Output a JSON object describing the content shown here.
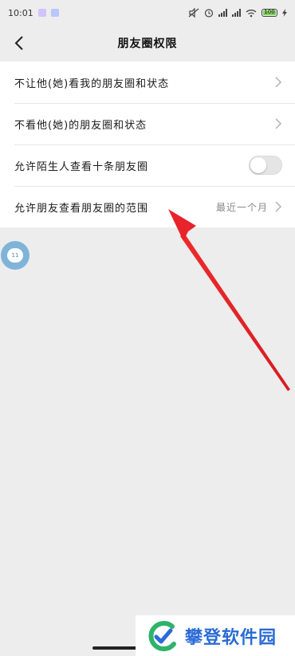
{
  "status_bar": {
    "time": "10:01",
    "battery_text": "100"
  },
  "nav": {
    "title": "朋友圈权限"
  },
  "settings": [
    {
      "label": "不让他(她)看我的朋友圈和状态"
    },
    {
      "label": "不看他(她)的朋友圈和状态"
    },
    {
      "label": "允许陌生人查看十条朋友圈"
    },
    {
      "label": "允许朋友查看朋友圈的范围",
      "value": "最近一个月"
    }
  ],
  "toggle_state": "off",
  "floating_ball_text": "11",
  "watermark": {
    "text": "攀登软件园"
  },
  "colors": {
    "arrow": "#e8232b",
    "watermark": "#2a6bd6",
    "background": "#ededed"
  }
}
